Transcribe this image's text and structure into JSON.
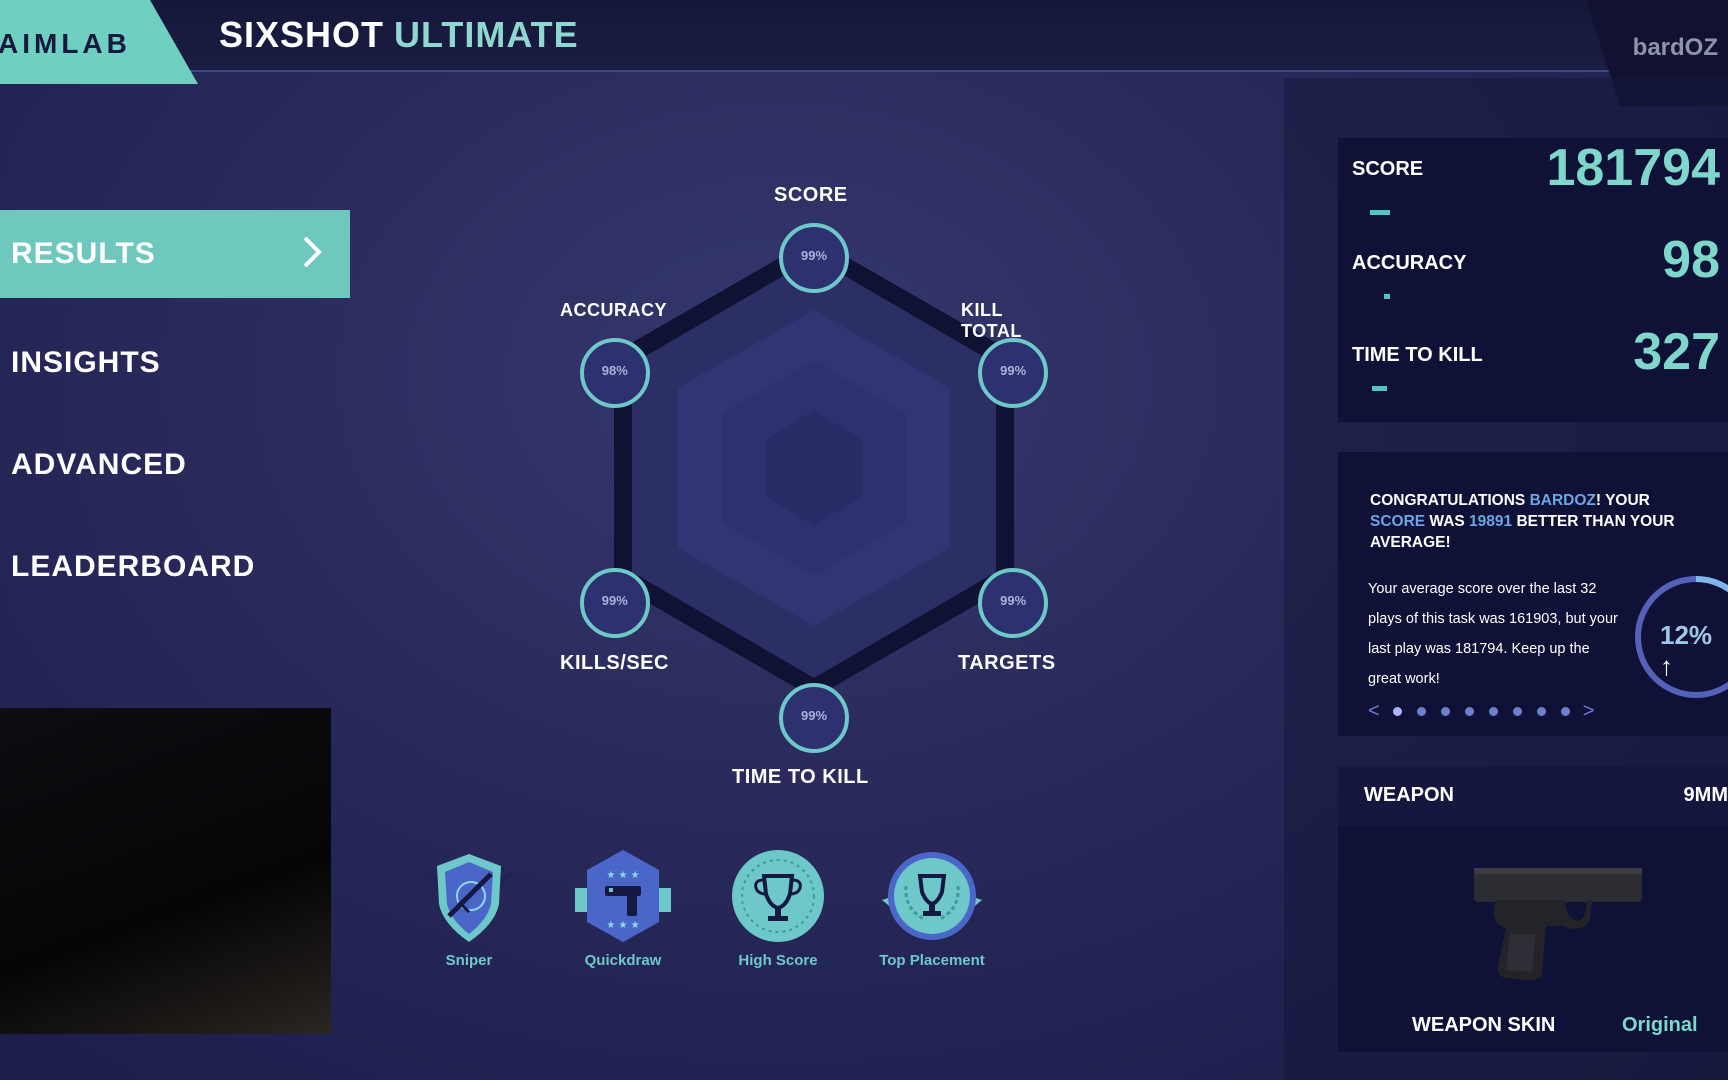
{
  "app": {
    "logo": "AIMLAB",
    "title_main": "SIXSHOT",
    "title_sub": "ULTIMATE",
    "username": "bardOZ"
  },
  "nav": {
    "items": [
      {
        "label": "RESULTS",
        "active": true
      },
      {
        "label": "INSIGHTS"
      },
      {
        "label": "ADVANCED"
      },
      {
        "label": "LEADERBOARD"
      }
    ]
  },
  "radar": {
    "axes": [
      {
        "label": "SCORE",
        "percent": "99%"
      },
      {
        "label": "KILL TOTAL",
        "percent": "99%"
      },
      {
        "label": "TARGETS",
        "percent": "99%"
      },
      {
        "label": "TIME TO KILL",
        "percent": "99%"
      },
      {
        "label": "KILLS/SEC",
        "percent": "99%"
      },
      {
        "label": "ACCURACY",
        "percent": "98%"
      }
    ]
  },
  "stats": [
    {
      "label": "SCORE",
      "value": "181794",
      "bar": 0.18
    },
    {
      "label": "ACCURACY",
      "value": "98",
      "bar": 0.05
    },
    {
      "label": "TIME TO KILL",
      "value": "327",
      "bar": 0.14
    }
  ],
  "insight": {
    "c1": "CONGRATULATIONS ",
    "c_name": "BARDOZ",
    "c2": "! YOUR ",
    "c_metric": "SCORE",
    "c3": " WAS ",
    "c_amount": "19891",
    "c4": " BETTER THAN YOUR AVERAGE!",
    "body": "Your average score over the last 32 plays of this task was 161903, but your last play was 181794. Keep up the great work!",
    "percent": "12%",
    "arrow": "↑",
    "prev": "<",
    "next": ">",
    "page_count": 8,
    "current_page": 1
  },
  "weapon": {
    "label": "WEAPON",
    "name": "9MM",
    "skin_label": "WEAPON SKIN",
    "skin_value": "Original"
  },
  "badges": [
    {
      "label": "Sniper",
      "icon": "sniper-badge-icon"
    },
    {
      "label": "Quickdraw",
      "icon": "quickdraw-badge-icon"
    },
    {
      "label": "High Score",
      "icon": "trophy-badge-icon"
    },
    {
      "label": "Top Placement",
      "icon": "laurel-trophy-badge-icon"
    }
  ],
  "colors": {
    "accent": "#6fc8be",
    "background": "#2a2b5c",
    "card": "#0f1236",
    "highlight_blue": "#6aa5e6"
  }
}
